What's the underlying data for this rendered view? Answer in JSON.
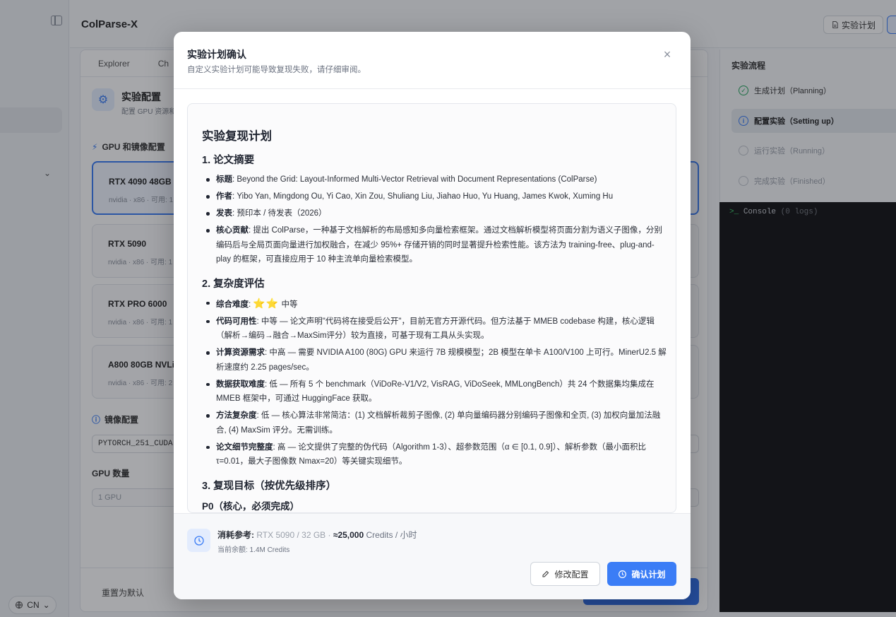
{
  "app": {
    "title": "ColParse-X",
    "plan_button": "实验计划",
    "lang": "CN"
  },
  "main": {
    "tabs": [
      "Explorer",
      "Ch"
    ],
    "config_title": "实验配置",
    "config_subtitle": "配置 GPU 资源和",
    "gpu_section": "GPU 和镜像配置",
    "gpus": [
      {
        "name": "RTX 4090 48GB",
        "meta": "nvidia · x86 · 可用: 1"
      },
      {
        "name": "RTX 5090",
        "meta": "nvidia · x86 · 可用: 1"
      },
      {
        "name": "RTX PRO 6000",
        "meta": "nvidia · x86 · 可用: 1"
      },
      {
        "name": "A800 80GB NVLink",
        "meta": "nvidia · x86 · 可用: 2"
      }
    ],
    "image_section": "镜像配置",
    "image_value": "PYTORCH_251_CUDA",
    "gpu_count_label": "GPU 数量",
    "gpu_count_value": "1 GPU",
    "reset_label": "重置为默认"
  },
  "workflow": {
    "title": "实验流程",
    "steps": [
      {
        "label": "生成计划（Planning）",
        "state": "done"
      },
      {
        "label": "配置实验（Setting up）",
        "state": "active"
      },
      {
        "label": "运行实验（Running）",
        "state": "pending"
      },
      {
        "label": "完成实验（Finished）",
        "state": "pending"
      }
    ],
    "console_label": "Console",
    "console_count": "(0 logs)"
  },
  "modal": {
    "title": "实验计划确认",
    "subtitle": "自定义实验计划可能导致复现失败，请仔细审阅。",
    "plan": {
      "title": "实验复现计划",
      "s1": {
        "heading": "1. 论文摘要",
        "items": [
          {
            "k": "标题",
            "v": ": Beyond the Grid: Layout-Informed Multi-Vector Retrieval with Document Representations (ColParse)"
          },
          {
            "k": "作者",
            "v": ": Yibo Yan, Mingdong Ou, Yi Cao, Xin Zou, Shuliang Liu, Jiahao Huo, Yu Huang, James Kwok, Xuming Hu"
          },
          {
            "k": "发表",
            "v": ": 预印本 / 待发表（2026）"
          },
          {
            "k": "核心贡献",
            "v": ": 提出 ColParse，一种基于文档解析的布局感知多向量检索框架。通过文档解析模型将页面分割为语义子图像，分别编码后与全局页面向量进行加权融合，在减少 95%+ 存储开销的同时显著提升检索性能。该方法为 training-free、plug-and-play 的框架，可直接应用于 10 种主流单向量检索模型。"
          }
        ]
      },
      "s2": {
        "heading": "2. 复杂度评估",
        "difficulty_key": "综合难度",
        "difficulty_stars": "⭐⭐",
        "difficulty_text": "中等",
        "items": [
          {
            "k": "代码可用性",
            "v": ": 中等 — 论文声明\"代码将在接受后公开\"，目前无官方开源代码。但方法基于 MMEB codebase 构建，核心逻辑（解析→编码→融合→MaxSim评分）较为直接，可基于现有工具从头实现。"
          },
          {
            "k": "计算资源需求",
            "v": ": 中高 — 需要 NVIDIA A100 (80G) GPU 来运行 7B 规模模型；2B 模型在单卡 A100/V100 上可行。MinerU2.5 解析速度约 2.25 pages/sec。"
          },
          {
            "k": "数据获取难度",
            "v": ": 低 — 所有 5 个 benchmark（ViDoRe-V1/V2, VisRAG, ViDoSeek, MMLongBench）共 24 个数据集均集成在 MMEB 框架中，可通过 HuggingFace 获取。"
          },
          {
            "k": "方法复杂度",
            "v": ": 低 — 核心算法非常简洁：(1) 文档解析裁剪子图像, (2) 单向量编码器分别编码子图像和全页, (3) 加权向量加法融合, (4) MaxSim 评分。无需训练。"
          },
          {
            "k": "论文细节完整度",
            "v": ": 高 — 论文提供了完整的伪代码（Algorithm 1-3）、超参数范围（α ∈ [0.1, 0.9]）、解析参数（最小面积比 τ=0.01，最大子图像数 Nmax=20）等关键实现细节。"
          }
        ]
      },
      "s3": {
        "heading": "3. 复现目标（按优先级排序）",
        "p0": "P0（核心，必须完成）"
      }
    },
    "footer": {
      "cost_label": "消耗参考:",
      "cost_gpu": "RTX 5090 / 32 GB ·",
      "cost_value": "≈25,000",
      "cost_unit": "Credits / 小时",
      "balance": "当前余额: 1.4M Credits",
      "edit_label": "修改配置",
      "confirm_label": "确认计划"
    }
  }
}
